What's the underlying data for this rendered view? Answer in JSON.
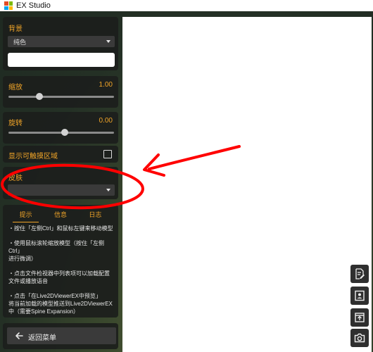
{
  "window": {
    "title": "EX Studio"
  },
  "sidebar": {
    "background": {
      "label": "背景",
      "type_selected": "纯色",
      "color_value": "#ffffff"
    },
    "scale": {
      "label": "缩放",
      "value": "1.00",
      "slider_fraction": 0.29
    },
    "rotation": {
      "label": "旋转",
      "value": "0.00",
      "slider_fraction": 0.53
    },
    "touch_area": {
      "label": "显示可触摸区域",
      "checked": false
    },
    "skin": {
      "label": "皮肤",
      "selected": ""
    },
    "info_panel": {
      "tabs": [
        "提示",
        "信息",
        "日志"
      ],
      "active_tab": "提示",
      "tips": [
        "・按住「左侧Ctrl」和鼠标左键来移动模型",
        "・使用鼠标滚轮缩放模型（按住「左侧Ctrl」\n进行微调）",
        "・点击文件检视器中列表项可以加载配置\n文件或播放语音",
        "・点击「在Live2DViewerEX中预览」\n将当前加载的模型推送到Live2DViewerEX\n中（需要Spine Expansion）"
      ]
    },
    "back_button": {
      "label": "返回菜单"
    }
  },
  "right_toolbar": {
    "buttons": [
      "edit-document-icon",
      "portrait-icon",
      "export-icon",
      "camera-icon"
    ]
  },
  "colors": {
    "accent": "#f0a428",
    "annotation": "#ff0000",
    "card_bg": "#1c1e1c",
    "viewport_bg": "#ffffff"
  }
}
